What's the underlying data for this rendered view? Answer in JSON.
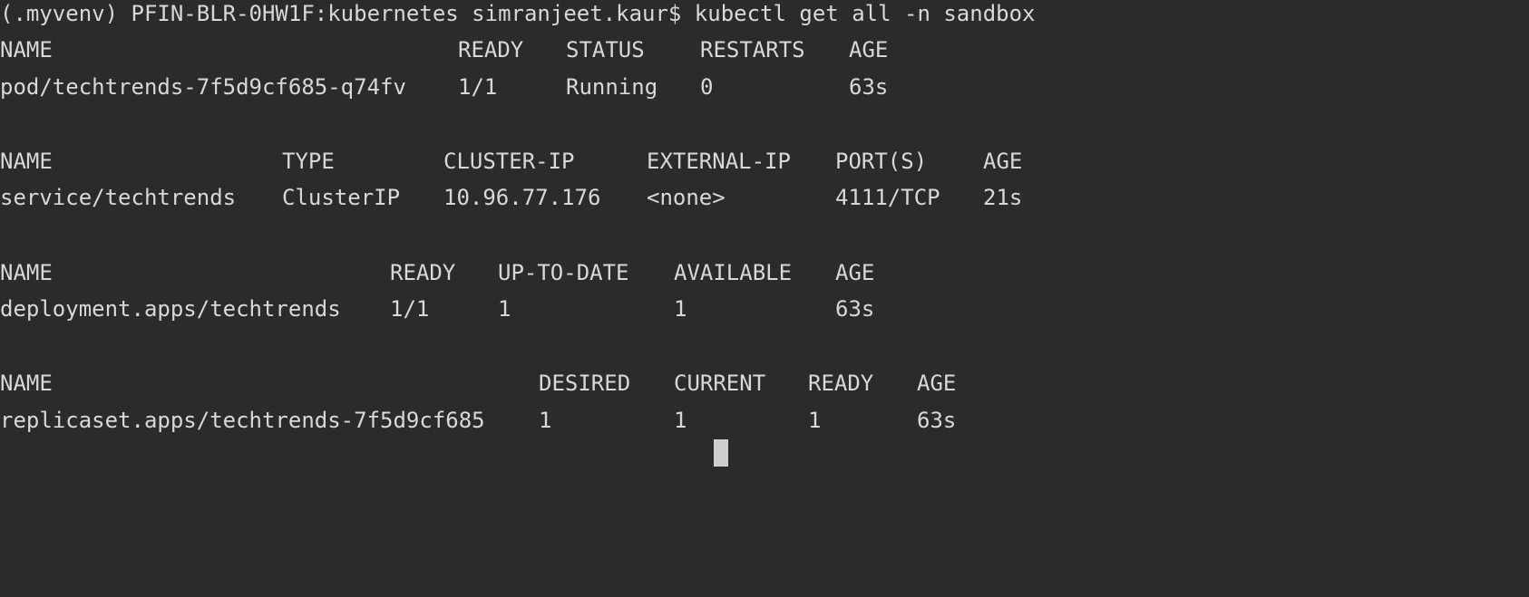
{
  "terminal": {
    "prompt_line": "(.myvenv) PFIN-BLR-0HW1F:kubernetes simranjeet.kaur$ kubectl get all -n sandbox",
    "pods": {
      "headers": [
        "NAME",
        "READY",
        "STATUS",
        "RESTARTS",
        "AGE"
      ],
      "row": [
        "pod/techtrends-7f5d9cf685-q74fv",
        "1/1",
        "Running",
        "0",
        "63s"
      ]
    },
    "services": {
      "headers": [
        "NAME",
        "TYPE",
        "CLUSTER-IP",
        "EXTERNAL-IP",
        "PORT(S)",
        "AGE"
      ],
      "row": [
        "service/techtrends",
        "ClusterIP",
        "10.96.77.176",
        "<none>",
        "4111/TCP",
        "21s"
      ]
    },
    "deployments": {
      "headers": [
        "NAME",
        "READY",
        "UP-TO-DATE",
        "AVAILABLE",
        "AGE"
      ],
      "row": [
        "deployment.apps/techtrends",
        "1/1",
        "1",
        "1",
        "63s"
      ]
    },
    "replicasets": {
      "headers": [
        "NAME",
        "DESIRED",
        "CURRENT",
        "READY",
        "AGE"
      ],
      "row": [
        "replicaset.apps/techtrends-7f5d9cf685",
        "1",
        "1",
        "1",
        "63s"
      ]
    }
  }
}
